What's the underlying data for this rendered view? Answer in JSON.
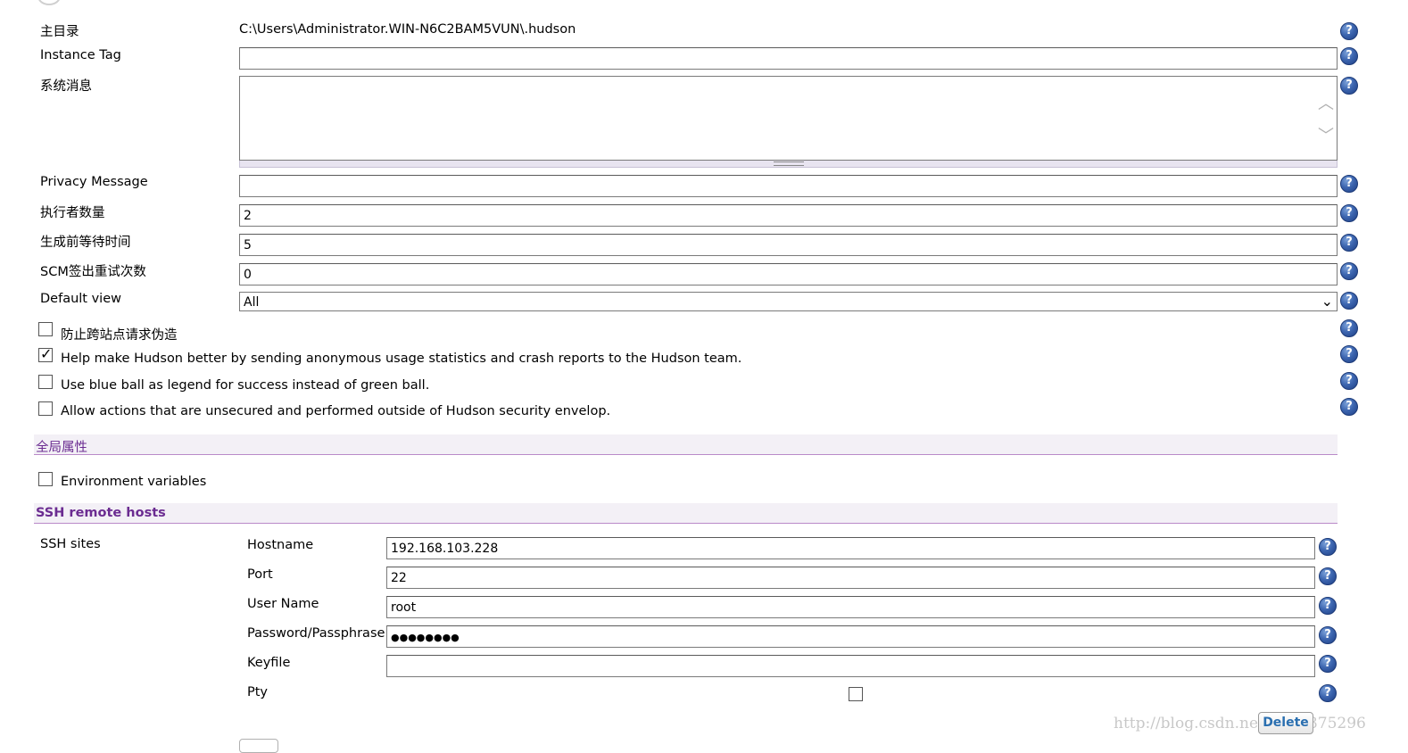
{
  "fields": {
    "home_dir": {
      "label": "主目录",
      "value": "C:\\Users\\Administrator.WIN-N6C2BAM5VUN\\.hudson"
    },
    "instance_tag": {
      "label": "Instance Tag",
      "value": ""
    },
    "system_message": {
      "label": "系统消息",
      "value": ""
    },
    "privacy_message": {
      "label": "Privacy Message",
      "value": ""
    },
    "executors": {
      "label": "执行者数量",
      "value": "2"
    },
    "quiet_period": {
      "label": "生成前等待时间",
      "value": "5"
    },
    "scm_retry": {
      "label": "SCM签出重试次数",
      "value": "0"
    },
    "default_view": {
      "label": "Default view",
      "selected": "All"
    }
  },
  "checkboxes": [
    {
      "label": "防止跨站点请求伪造",
      "checked": false
    },
    {
      "label": "Help make Hudson better by sending anonymous usage statistics and crash reports to the Hudson team.",
      "checked": true
    },
    {
      "label": "Use blue ball as legend for success instead of green ball.",
      "checked": false
    },
    {
      "label": "Allow actions that are unsecured and performed outside of Hudson security envelop.",
      "checked": false
    }
  ],
  "sections": {
    "global_props": {
      "title": "全局属性",
      "env_label": "Environment variables",
      "env_checked": false
    },
    "ssh": {
      "title": "SSH remote hosts"
    }
  },
  "ssh_sites": {
    "label": "SSH sites",
    "hostname": {
      "label": "Hostname",
      "value": "192.168.103.228"
    },
    "port": {
      "label": "Port",
      "value": "22"
    },
    "username": {
      "label": "User Name",
      "value": "root"
    },
    "password": {
      "label": "Password/Passphrase",
      "value": "●●●●●●●●"
    },
    "keyfile": {
      "label": "Keyfile",
      "value": ""
    },
    "pty": {
      "label": "Pty",
      "checked": false
    },
    "delete_label": "Delete"
  },
  "icons": {
    "help": "help-icon",
    "help_glyph": "?"
  },
  "watermark": "http://blog.csdn.net/u011375296",
  "colors": {
    "section_text": "#6b2c91",
    "section_line": "#b98ac9",
    "help_blue": "#3d66b0",
    "delete_text": "#2a6fb0"
  }
}
